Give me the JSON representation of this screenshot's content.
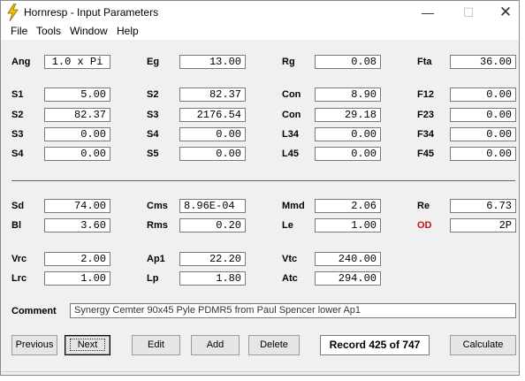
{
  "window": {
    "title": "Hornresp - Input Parameters",
    "icon": "lightning-bolt-icon",
    "controls": {
      "minimize": "—",
      "maximize": "☐",
      "close": "✕"
    }
  },
  "menu": [
    "File",
    "Tools",
    "Window",
    "Help"
  ],
  "row1": [
    {
      "label": "Ang",
      "value": "1.0 x Pi"
    },
    {
      "label": "Eg",
      "value": "13.00"
    },
    {
      "label": "Rg",
      "value": "0.08"
    },
    {
      "label": "Fta",
      "value": "36.00"
    }
  ],
  "grid": {
    "col1": [
      {
        "label": "S1",
        "value": "5.00"
      },
      {
        "label": "S2",
        "value": "82.37"
      },
      {
        "label": "S3",
        "value": "0.00"
      },
      {
        "label": "S4",
        "value": "0.00"
      }
    ],
    "col2": [
      {
        "label": "S2",
        "value": "82.37"
      },
      {
        "label": "S3",
        "value": "2176.54"
      },
      {
        "label": "S4",
        "value": "0.00"
      },
      {
        "label": "S5",
        "value": "0.00"
      }
    ],
    "col3": [
      {
        "label": "Con",
        "value": "8.90"
      },
      {
        "label": "Con",
        "value": "29.18"
      },
      {
        "label": "L34",
        "value": "0.00"
      },
      {
        "label": "L45",
        "value": "0.00"
      }
    ],
    "col4": [
      {
        "label": "F12",
        "value": "0.00"
      },
      {
        "label": "F23",
        "value": "0.00"
      },
      {
        "label": "F34",
        "value": "0.00"
      },
      {
        "label": "F45",
        "value": "0.00"
      }
    ]
  },
  "driver": {
    "sd": {
      "label": "Sd",
      "value": "74.00"
    },
    "cms": {
      "label": "Cms",
      "value": "8.96E-04"
    },
    "mmd": {
      "label": "Mmd",
      "value": "2.06"
    },
    "re": {
      "label": "Re",
      "value": "6.73"
    },
    "bl": {
      "label": "Bl",
      "value": "3.60"
    },
    "rms": {
      "label": "Rms",
      "value": "0.20"
    },
    "le": {
      "label": "Le",
      "value": "1.00"
    },
    "od": {
      "label": "OD",
      "value": "2P",
      "label_color": "#d01010"
    }
  },
  "chamber": {
    "vrc": {
      "label": "Vrc",
      "value": "2.00"
    },
    "ap1": {
      "label": "Ap1",
      "value": "22.20"
    },
    "vtc": {
      "label": "Vtc",
      "value": "240.00"
    },
    "lrc": {
      "label": "Lrc",
      "value": "1.00"
    },
    "lp": {
      "label": "Lp",
      "value": "1.80"
    },
    "atc": {
      "label": "Atc",
      "value": "294.00"
    }
  },
  "comment": {
    "label": "Comment",
    "value": "Synergy  Cemter 90x45 Pyle PDMR5 from Paul Spencer  lower Ap1"
  },
  "buttons": {
    "previous": "Previous",
    "next": "Next",
    "edit": "Edit",
    "add": "Add",
    "delete": "Delete",
    "record": "Record 425 of 747",
    "calculate": "Calculate"
  }
}
